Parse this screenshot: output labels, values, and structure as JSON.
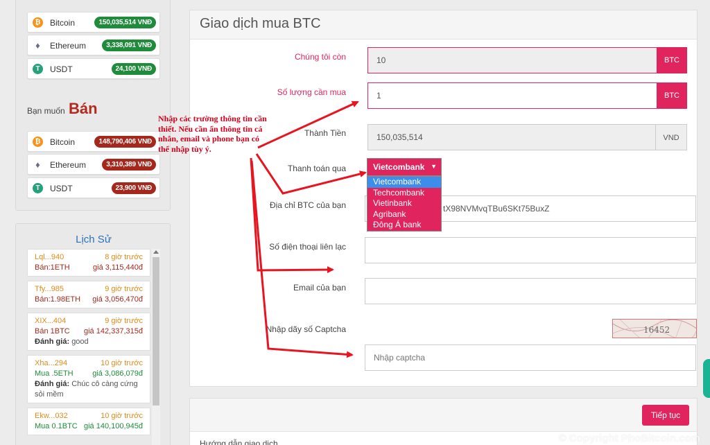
{
  "buy_prices": [
    {
      "coin": "Bitcoin",
      "icon": "bitcoin-icon",
      "price": "150,035,514 VNĐ"
    },
    {
      "coin": "Ethereum",
      "icon": "ethereum-icon",
      "price": "3,338,091 VNĐ"
    },
    {
      "coin": "USDT",
      "icon": "tether-icon",
      "price": "24,100 VNĐ"
    }
  ],
  "sell_heading": {
    "prefix": "Bạn muốn",
    "emphasis": "Bán"
  },
  "sell_prices": [
    {
      "coin": "Bitcoin",
      "icon": "bitcoin-icon",
      "price": "148,790,406 VNĐ"
    },
    {
      "coin": "Ethereum",
      "icon": "ethereum-icon",
      "price": "3,310,389 VNĐ"
    },
    {
      "coin": "USDT",
      "icon": "tether-icon",
      "price": "23,900 VNĐ"
    }
  ],
  "history": {
    "title": "Lịch Sử",
    "items": [
      {
        "user": "Lql...940",
        "time": "8 giờ trước",
        "action": "Bán:1ETH",
        "price": "giá 3,115,440đ",
        "type": "sell"
      },
      {
        "user": "Tfy...985",
        "time": "9 giờ trước",
        "action": "Bán:1.98ETH",
        "price": "giá 3,056,470đ",
        "type": "sell"
      },
      {
        "user": "XIX...404",
        "time": "9 giờ trước",
        "action": "Bán 1BTC",
        "price": "giá 142,337,315đ",
        "type": "sell",
        "rating_label": "Đánh giá:",
        "rating": "good"
      },
      {
        "user": "Xha...294",
        "time": "10 giờ trước",
        "action": "Mua .5ETH",
        "price": "giá 3,086,079đ",
        "type": "buy",
        "rating_label": "Đánh giá:",
        "rating": "Chúc cô càng cứng sỏi mềm"
      },
      {
        "user": "Ekw...032",
        "time": "10 giờ trước",
        "action": "Mua 0.1BTC",
        "price": "giá 140,100,945đ",
        "type": "buy"
      }
    ]
  },
  "form": {
    "title": "Giao dịch mua BTC",
    "stock_label": "Chúng tôi còn",
    "stock_value": "10",
    "stock_unit": "BTC",
    "qty_label": "Số lượng cần mua",
    "qty_value": "1",
    "qty_unit": "BTC",
    "total_label": "Thành Tiền",
    "total_value": "150,035,514",
    "total_unit": "VND",
    "payment_label": "Thanh toán qua",
    "payment_selected": "Vietcombank",
    "payment_options": [
      "Vietcombank",
      "Techcombank",
      "Vietinbank",
      "Agribank",
      "Đông Á bank"
    ],
    "address_label": "Địa chỉ BTC của bạn",
    "address_value": "tX98NVMvqTBu6SKt75BuxZ",
    "phone_label": "Số điện thoại liên lạc",
    "email_label": "Email của bạn",
    "captcha_label": "Nhập dãy số Captcha",
    "captcha_text": "16452",
    "captcha_placeholder": "Nhập captcha",
    "next_button": "Tiếp tục",
    "guide_title": "Hướng dẫn giao dịch"
  },
  "annotation": "Nhập các trường thông tin cần thiết. Nếu cần ẩn thông tin cá nhân, email và phone bạn có thể nhập tùy ý.",
  "watermark": "© Copyright PhoBitcoin.com",
  "colors": {
    "accent": "#e0245e",
    "buy": "#1e8c3a",
    "sell": "#a6281c",
    "link": "#2a72b5",
    "annotation": "#d6001c"
  }
}
